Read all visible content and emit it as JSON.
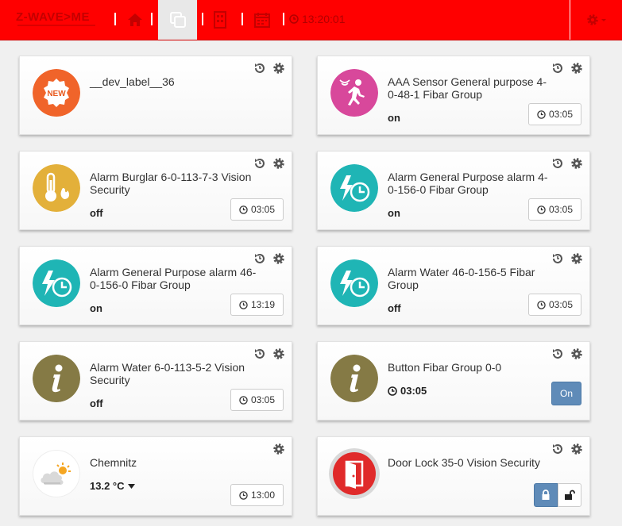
{
  "header": {
    "logo": "Z-WAVE>ME",
    "clock": "13:20:01",
    "colors": {
      "bar": "#ff0000",
      "accent": "#5f8bb8"
    },
    "nav": [
      "home-icon",
      "elements-icon",
      "rooms-icon",
      "events-icon"
    ]
  },
  "cards": [
    {
      "title": "__dev_label__36",
      "icon": "new-badge-icon",
      "level": "",
      "time": ""
    },
    {
      "title": "AAA Sensor General purpose 4-0-48-1 Fibar Group",
      "icon": "motion-sensor-icon",
      "level": "on",
      "time": "03:05"
    },
    {
      "title": "Alarm Burglar 6-0-113-7-3 Vision Security",
      "icon": "temperature-alarm-icon",
      "level": "off",
      "time": "03:05"
    },
    {
      "title": "Alarm General Purpose alarm 4-0-156-0 Fibar Group",
      "icon": "alarm-clock-icon",
      "level": "on",
      "time": "03:05"
    },
    {
      "title": "Alarm General Purpose alarm 46-0-156-0 Fibar Group",
      "icon": "alarm-clock-icon",
      "level": "on",
      "time": "13:19"
    },
    {
      "title": "Alarm Water 46-0-156-5 Fibar Group",
      "icon": "alarm-clock-icon",
      "level": "off",
      "time": "03:05"
    },
    {
      "title": "Alarm Water 6-0-113-5-2 Vision Security",
      "icon": "info-icon",
      "level": "off",
      "time": "03:05"
    },
    {
      "title": "Button Fibar Group 0-0",
      "icon": "info-icon",
      "level": "03:05",
      "button": "On"
    },
    {
      "title": "Chemnitz",
      "icon": "weather-icon",
      "level": "13.2 °C",
      "time": "13:00"
    },
    {
      "title": "Door Lock 35-0 Vision Security",
      "icon": "door-icon",
      "level": ""
    }
  ]
}
